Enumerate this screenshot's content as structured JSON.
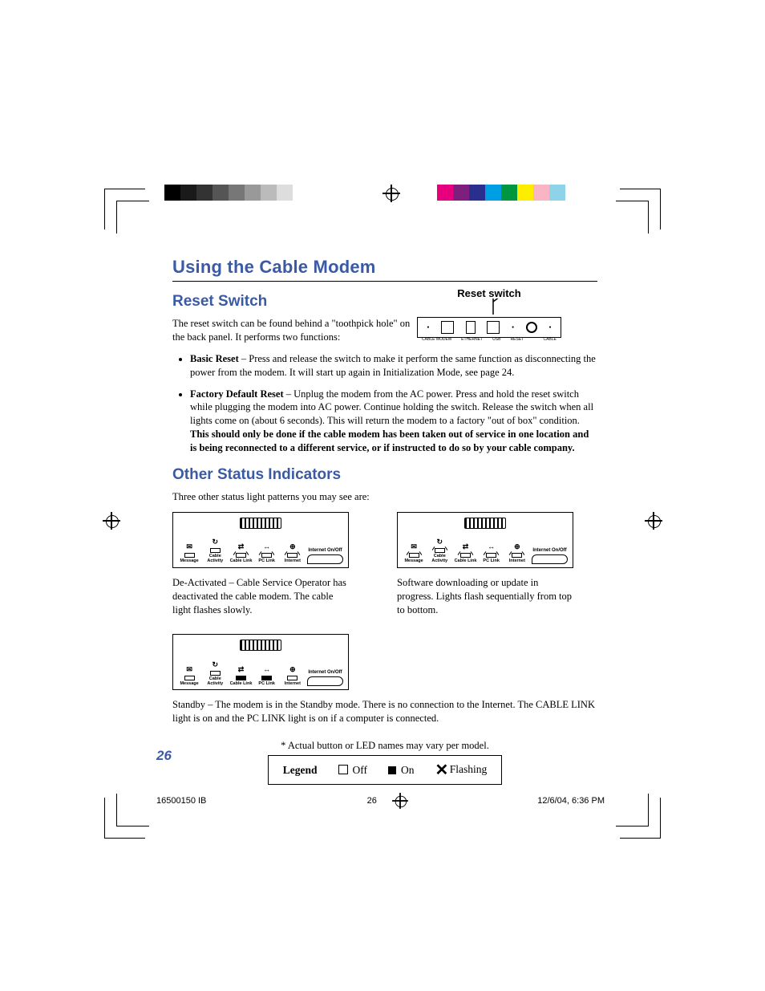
{
  "chapter_title": "Using the Cable Modem",
  "section1": {
    "title": "Reset Switch",
    "intro": "The reset switch can be found behind a \"toothpick hole\" on the back panel. It performs two functions:",
    "fig_label": "Reset switch",
    "bullets": [
      {
        "lead": "Basic Reset",
        "text": " – Press and release the switch to make it perform the same function as disconnecting the power from the modem. It will start up again in Initialization Mode, see page 24."
      },
      {
        "lead": "Factory Default Reset",
        "text_a": " – Unplug the modem from the AC power. Press and hold the reset switch while plugging the modem into AC power. Continue holding the switch. Release the switch when all lights come on (about 6 seconds). This will return the modem to a factory \"out of box\" condition. ",
        "bold": "This should only be done if the cable modem has been taken out of service in one location and is being reconnected to a different service, or if instructed to do so by your cable company."
      }
    ]
  },
  "section2": {
    "title": "Other Status Indicators",
    "intro": "Three other status light patterns you may see are:",
    "modems": [
      {
        "caption": "De-Activated – Cable Service Operator has deactivated the cable modem. The cable light  flashes slowly."
      },
      {
        "caption": "Software downloading or update in progress. Lights flash sequentially from top to bottom."
      },
      {
        "caption": "Standby – The modem is in the Standby mode. There is no connection to the Internet. The CABLE LINK light is on and the PC LINK light is on if a computer is connected."
      }
    ],
    "led_labels": [
      "Message",
      "Cable Activity",
      "Cable Link",
      "PC Link",
      "Internet"
    ],
    "onoff_label": "Internet On/Off"
  },
  "legend": {
    "note": "* Actual button or LED names may vary per model.",
    "title": "Legend",
    "off": "Off",
    "on": "On",
    "flashing": "Flashing"
  },
  "page_number": "26",
  "footer": {
    "left": "16500150 IB",
    "center": "26",
    "right": "12/6/04, 6:36 PM"
  },
  "back_panel_labels": [
    "CABLE MODEM",
    "ETHERNET",
    "USB",
    "RESET",
    "",
    "CABLE"
  ]
}
